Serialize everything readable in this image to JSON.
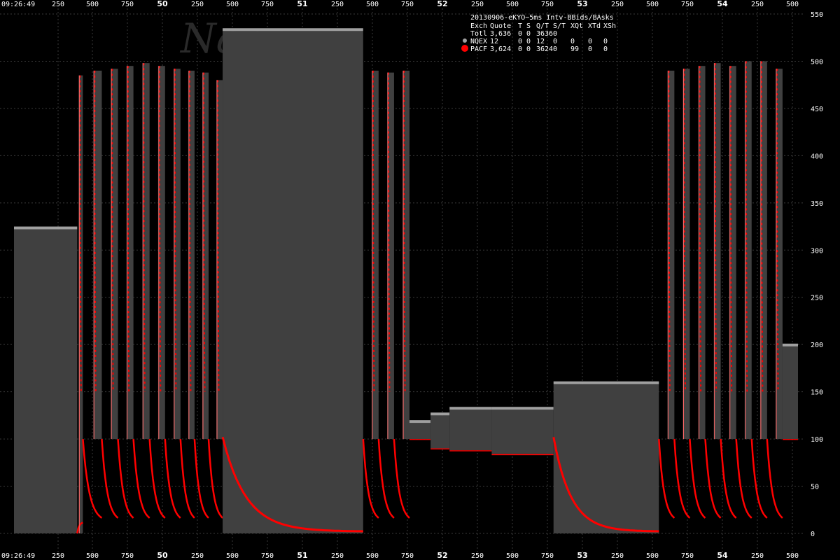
{
  "chart_data": {
    "type": "area",
    "title": "20130906-eKYO~5ms Intv-BBids/BAsks",
    "watermark": "Nanex",
    "x_start_label": "09:26:49",
    "x_tick_labels": [
      "250",
      "500",
      "750",
      "50",
      "250",
      "500",
      "750",
      "51",
      "250",
      "500",
      "750",
      "52",
      "250",
      "500",
      "750",
      "53",
      "250",
      "500",
      "750",
      "54",
      "250",
      "500"
    ],
    "x_major_labels": [
      "50",
      "51",
      "52",
      "53",
      "54"
    ],
    "ylim": [
      0,
      550
    ],
    "y_ticks": [
      0,
      50,
      100,
      150,
      200,
      250,
      300,
      350,
      400,
      450,
      500,
      550
    ],
    "grid": true,
    "colors": {
      "background": "#000000",
      "spread": "#404040",
      "bid": "#ff0000",
      "ask": "#a0a0a0",
      "grid": "#3a3a3a"
    },
    "legend": {
      "header": [
        "Exch",
        "Quote",
        "T",
        "S",
        "Q/T",
        "S/T",
        "XQt",
        "XTd",
        "XSh"
      ],
      "rows": [
        {
          "exch": "Totl",
          "quote": "3,636",
          "t": "0",
          "s": "0",
          "qt": "3636",
          "st": "0",
          "xqt": "",
          "xtd": "",
          "xsh": "",
          "color": ""
        },
        {
          "exch": "NQEX",
          "quote": "12",
          "t": "0",
          "s": "0",
          "qt": "12",
          "st": "0",
          "xqt": "0",
          "xtd": "0",
          "xsh": "0",
          "color": "#a0a0a0"
        },
        {
          "exch": "PACF",
          "quote": "3,624",
          "t": "0",
          "s": "0",
          "qt": "3624",
          "st": "0",
          "xqt": "99",
          "xtd": "0",
          "xsh": "0",
          "color": "#ff0000"
        }
      ]
    },
    "segments": [
      {
        "x0": 0.0,
        "x1": 0.09,
        "bid": 0,
        "ask": 322
      },
      {
        "x0": 0.09,
        "x1": 0.098,
        "bid": 0,
        "ask": 485,
        "kind": "sweep"
      },
      {
        "x0": 0.098,
        "x1": 0.125,
        "bid": 100,
        "ask": 490,
        "kind": "sweep"
      },
      {
        "x0": 0.125,
        "x1": 0.148,
        "bid": 100,
        "ask": 492,
        "kind": "sweep"
      },
      {
        "x0": 0.148,
        "x1": 0.17,
        "bid": 100,
        "ask": 495,
        "kind": "sweep"
      },
      {
        "x0": 0.17,
        "x1": 0.193,
        "bid": 100,
        "ask": 498,
        "kind": "sweep"
      },
      {
        "x0": 0.193,
        "x1": 0.215,
        "bid": 100,
        "ask": 495,
        "kind": "sweep"
      },
      {
        "x0": 0.215,
        "x1": 0.237,
        "bid": 100,
        "ask": 492,
        "kind": "sweep"
      },
      {
        "x0": 0.237,
        "x1": 0.257,
        "bid": 100,
        "ask": 490,
        "kind": "sweep"
      },
      {
        "x0": 0.257,
        "x1": 0.277,
        "bid": 100,
        "ask": 488,
        "kind": "sweep"
      },
      {
        "x0": 0.277,
        "x1": 0.297,
        "bid": 100,
        "ask": 480,
        "kind": "sweep"
      },
      {
        "x0": 0.297,
        "x1": 0.497,
        "bid": 0,
        "ask": 532
      },
      {
        "x0": 0.497,
        "x1": 0.519,
        "bid": 100,
        "ask": 490,
        "kind": "sweep"
      },
      {
        "x0": 0.519,
        "x1": 0.541,
        "bid": 100,
        "ask": 488,
        "kind": "sweep"
      },
      {
        "x0": 0.541,
        "x1": 0.563,
        "bid": 100,
        "ask": 490,
        "kind": "sweep"
      },
      {
        "x0": 0.563,
        "x1": 0.593,
        "bid": 100,
        "ask": 117
      },
      {
        "x0": 0.593,
        "x1": 0.62,
        "bid": 90,
        "ask": 125
      },
      {
        "x0": 0.62,
        "x1": 0.68,
        "bid": 88,
        "ask": 131
      },
      {
        "x0": 0.68,
        "x1": 0.768,
        "bid": 84,
        "ask": 131
      },
      {
        "x0": 0.768,
        "x1": 0.918,
        "bid": 0,
        "ask": 158
      },
      {
        "x0": 0.918,
        "x1": 0.94,
        "bid": 100,
        "ask": 490,
        "kind": "sweep"
      },
      {
        "x0": 0.94,
        "x1": 0.962,
        "bid": 100,
        "ask": 492,
        "kind": "sweep"
      },
      {
        "x0": 0.962,
        "x1": 0.984,
        "bid": 100,
        "ask": 495,
        "kind": "sweep"
      },
      {
        "x0": 0.984,
        "x1": 1.006,
        "bid": 100,
        "ask": 498,
        "kind": "sweep"
      },
      {
        "x0": 1.006,
        "x1": 1.028,
        "bid": 100,
        "ask": 495,
        "kind": "sweep"
      },
      {
        "x0": 1.028,
        "x1": 1.05,
        "bid": 100,
        "ask": 500,
        "kind": "sweep"
      },
      {
        "x0": 1.05,
        "x1": 1.072,
        "bid": 100,
        "ask": 500,
        "kind": "sweep"
      },
      {
        "x0": 1.072,
        "x1": 1.094,
        "bid": 100,
        "ask": 492,
        "kind": "sweep"
      },
      {
        "x0": 1.094,
        "x1": 1.116,
        "bid": 100,
        "ask": 198
      }
    ]
  }
}
